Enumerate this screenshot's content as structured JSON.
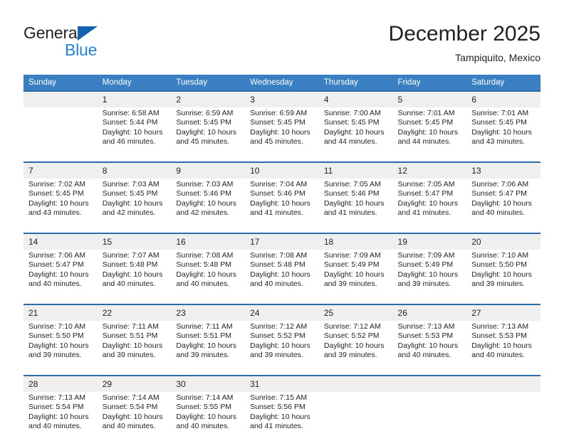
{
  "brand": {
    "name_part1": "General",
    "name_part2": "Blue",
    "logo_icon": "triangle-logo-icon",
    "color_primary": "#1263b0",
    "color_secondary": "#1f83d8"
  },
  "header": {
    "title": "December 2025",
    "location": "Tampiquito, Mexico"
  },
  "theme": {
    "header_row_bg": "#3a7fc1",
    "week_separator": "#2b6cab",
    "daynum_band_bg": "#efefef",
    "cell_bg": "#ffffff",
    "text": "#231f20"
  },
  "weekday_headers": [
    "Sunday",
    "Monday",
    "Tuesday",
    "Wednesday",
    "Thursday",
    "Friday",
    "Saturday"
  ],
  "weeks": [
    {
      "days": [
        {
          "date": "",
          "lines": []
        },
        {
          "date": "1",
          "lines": [
            "Sunrise: 6:58 AM",
            "Sunset: 5:44 PM",
            "Daylight: 10 hours",
            "and 46 minutes."
          ]
        },
        {
          "date": "2",
          "lines": [
            "Sunrise: 6:59 AM",
            "Sunset: 5:45 PM",
            "Daylight: 10 hours",
            "and 45 minutes."
          ]
        },
        {
          "date": "3",
          "lines": [
            "Sunrise: 6:59 AM",
            "Sunset: 5:45 PM",
            "Daylight: 10 hours",
            "and 45 minutes."
          ]
        },
        {
          "date": "4",
          "lines": [
            "Sunrise: 7:00 AM",
            "Sunset: 5:45 PM",
            "Daylight: 10 hours",
            "and 44 minutes."
          ]
        },
        {
          "date": "5",
          "lines": [
            "Sunrise: 7:01 AM",
            "Sunset: 5:45 PM",
            "Daylight: 10 hours",
            "and 44 minutes."
          ]
        },
        {
          "date": "6",
          "lines": [
            "Sunrise: 7:01 AM",
            "Sunset: 5:45 PM",
            "Daylight: 10 hours",
            "and 43 minutes."
          ]
        }
      ]
    },
    {
      "days": [
        {
          "date": "7",
          "lines": [
            "Sunrise: 7:02 AM",
            "Sunset: 5:45 PM",
            "Daylight: 10 hours",
            "and 43 minutes."
          ]
        },
        {
          "date": "8",
          "lines": [
            "Sunrise: 7:03 AM",
            "Sunset: 5:45 PM",
            "Daylight: 10 hours",
            "and 42 minutes."
          ]
        },
        {
          "date": "9",
          "lines": [
            "Sunrise: 7:03 AM",
            "Sunset: 5:46 PM",
            "Daylight: 10 hours",
            "and 42 minutes."
          ]
        },
        {
          "date": "10",
          "lines": [
            "Sunrise: 7:04 AM",
            "Sunset: 5:46 PM",
            "Daylight: 10 hours",
            "and 41 minutes."
          ]
        },
        {
          "date": "11",
          "lines": [
            "Sunrise: 7:05 AM",
            "Sunset: 5:46 PM",
            "Daylight: 10 hours",
            "and 41 minutes."
          ]
        },
        {
          "date": "12",
          "lines": [
            "Sunrise: 7:05 AM",
            "Sunset: 5:47 PM",
            "Daylight: 10 hours",
            "and 41 minutes."
          ]
        },
        {
          "date": "13",
          "lines": [
            "Sunrise: 7:06 AM",
            "Sunset: 5:47 PM",
            "Daylight: 10 hours",
            "and 40 minutes."
          ]
        }
      ]
    },
    {
      "days": [
        {
          "date": "14",
          "lines": [
            "Sunrise: 7:06 AM",
            "Sunset: 5:47 PM",
            "Daylight: 10 hours",
            "and 40 minutes."
          ]
        },
        {
          "date": "15",
          "lines": [
            "Sunrise: 7:07 AM",
            "Sunset: 5:48 PM",
            "Daylight: 10 hours",
            "and 40 minutes."
          ]
        },
        {
          "date": "16",
          "lines": [
            "Sunrise: 7:08 AM",
            "Sunset: 5:48 PM",
            "Daylight: 10 hours",
            "and 40 minutes."
          ]
        },
        {
          "date": "17",
          "lines": [
            "Sunrise: 7:08 AM",
            "Sunset: 5:48 PM",
            "Daylight: 10 hours",
            "and 40 minutes."
          ]
        },
        {
          "date": "18",
          "lines": [
            "Sunrise: 7:09 AM",
            "Sunset: 5:49 PM",
            "Daylight: 10 hours",
            "and 39 minutes."
          ]
        },
        {
          "date": "19",
          "lines": [
            "Sunrise: 7:09 AM",
            "Sunset: 5:49 PM",
            "Daylight: 10 hours",
            "and 39 minutes."
          ]
        },
        {
          "date": "20",
          "lines": [
            "Sunrise: 7:10 AM",
            "Sunset: 5:50 PM",
            "Daylight: 10 hours",
            "and 39 minutes."
          ]
        }
      ]
    },
    {
      "days": [
        {
          "date": "21",
          "lines": [
            "Sunrise: 7:10 AM",
            "Sunset: 5:50 PM",
            "Daylight: 10 hours",
            "and 39 minutes."
          ]
        },
        {
          "date": "22",
          "lines": [
            "Sunrise: 7:11 AM",
            "Sunset: 5:51 PM",
            "Daylight: 10 hours",
            "and 39 minutes."
          ]
        },
        {
          "date": "23",
          "lines": [
            "Sunrise: 7:11 AM",
            "Sunset: 5:51 PM",
            "Daylight: 10 hours",
            "and 39 minutes."
          ]
        },
        {
          "date": "24",
          "lines": [
            "Sunrise: 7:12 AM",
            "Sunset: 5:52 PM",
            "Daylight: 10 hours",
            "and 39 minutes."
          ]
        },
        {
          "date": "25",
          "lines": [
            "Sunrise: 7:12 AM",
            "Sunset: 5:52 PM",
            "Daylight: 10 hours",
            "and 39 minutes."
          ]
        },
        {
          "date": "26",
          "lines": [
            "Sunrise: 7:13 AM",
            "Sunset: 5:53 PM",
            "Daylight: 10 hours",
            "and 40 minutes."
          ]
        },
        {
          "date": "27",
          "lines": [
            "Sunrise: 7:13 AM",
            "Sunset: 5:53 PM",
            "Daylight: 10 hours",
            "and 40 minutes."
          ]
        }
      ]
    },
    {
      "days": [
        {
          "date": "28",
          "lines": [
            "Sunrise: 7:13 AM",
            "Sunset: 5:54 PM",
            "Daylight: 10 hours",
            "and 40 minutes."
          ]
        },
        {
          "date": "29",
          "lines": [
            "Sunrise: 7:14 AM",
            "Sunset: 5:54 PM",
            "Daylight: 10 hours",
            "and 40 minutes."
          ]
        },
        {
          "date": "30",
          "lines": [
            "Sunrise: 7:14 AM",
            "Sunset: 5:55 PM",
            "Daylight: 10 hours",
            "and 40 minutes."
          ]
        },
        {
          "date": "31",
          "lines": [
            "Sunrise: 7:15 AM",
            "Sunset: 5:56 PM",
            "Daylight: 10 hours",
            "and 41 minutes."
          ]
        },
        {
          "date": "",
          "lines": []
        },
        {
          "date": "",
          "lines": []
        },
        {
          "date": "",
          "lines": []
        }
      ]
    }
  ]
}
